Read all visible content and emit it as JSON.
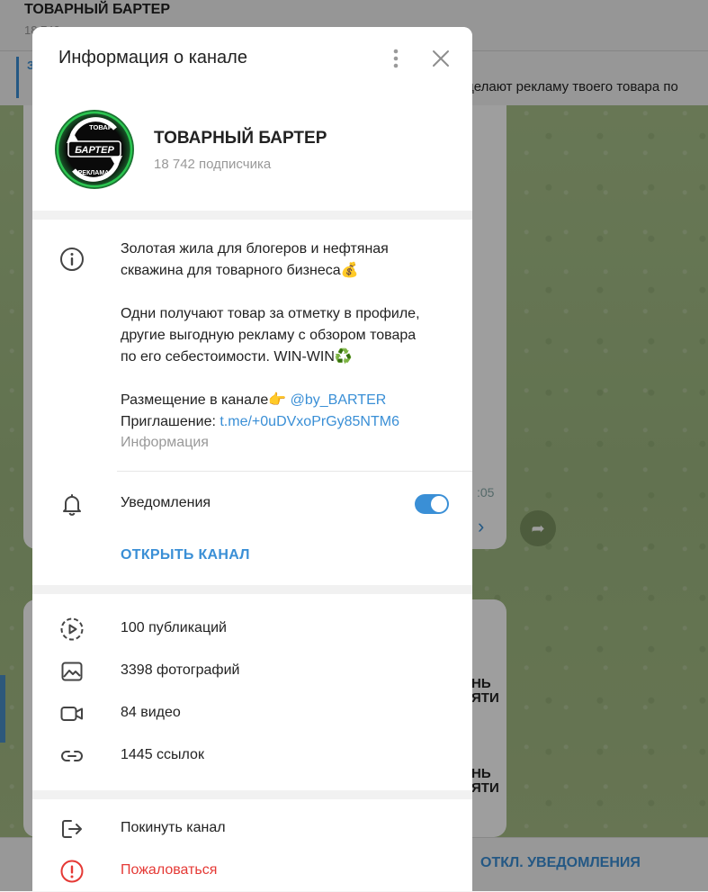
{
  "background": {
    "chat_title": "ТОВАРНЫЙ БАРТЕР",
    "chat_subtitle": "18 742",
    "pinned_label": "З",
    "pinned_text": "делают рекламу твоего товара по",
    "message_time": ":05",
    "ad_text_line1": "НЬ",
    "ad_text_line2": "ЯТИ",
    "bottom_button": "ОТКЛ. УВЕДОМЛЕНИЯ"
  },
  "modal": {
    "title": "Информация о канале",
    "channel": {
      "name": "ТОВАРНЫЙ БАРТЕР",
      "subscribers": "18 742 подписчика",
      "avatar_text_top": "ТОВАР",
      "avatar_text_middle": "БАРТЕР",
      "avatar_text_bottom": "РЕКЛАМА"
    },
    "description": {
      "line1": "Золотая жила для блогеров и нефтяная",
      "line2": "скважина для товарного бизнеса💰",
      "line3": "Одни получают товар за отметку в профиле,",
      "line4": "другие выгодную рекламу с обзором товара",
      "line5": "по его себестоимости. WIN-WIN♻️",
      "placement_label": "Размещение в канале👉",
      "placement_link": "@by_BARTER",
      "invite_label": "Приглашение:",
      "invite_link": "t.me/+0uDVxoPrGy85NTM6",
      "caption": "Информация"
    },
    "notifications": {
      "label": "Уведомления",
      "enabled": true
    },
    "open_channel": "ОТКРЫТЬ КАНАЛ",
    "media": {
      "publications": "100 публикаций",
      "photos": "3398 фотографий",
      "videos": "84 видео",
      "links": "1445 ссылок"
    },
    "actions": {
      "leave": "Покинуть канал",
      "report": "Пожаловаться"
    }
  },
  "colors": {
    "accent": "#3a8fd6",
    "danger": "#e53935",
    "avatar_ring": "#2fe05a"
  }
}
